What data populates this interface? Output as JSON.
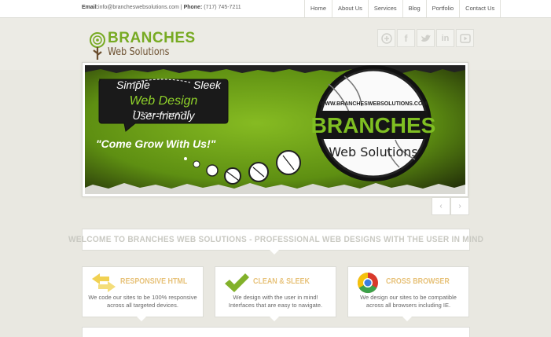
{
  "topbar": {
    "email_label": "Email:",
    "email_value": "info@brancheswebsolutions.com",
    "separator": " | ",
    "phone_label": "Phone:",
    "phone_value": "(717) 745-7211"
  },
  "nav": [
    "Home",
    "About Us",
    "Services",
    "Blog",
    "Portfolio",
    "Contact Us"
  ],
  "logo": {
    "top": "BRANCHES",
    "bottom": "Web Solutions"
  },
  "social_icons": [
    "rss-icon",
    "facebook-icon",
    "twitter-icon",
    "linkedin-icon",
    "youtube-icon"
  ],
  "slide": {
    "bubble_top_left": "Simple",
    "bubble_top_right": "Sleek",
    "bubble_main": "Web Design",
    "bubble_bottom": "User-friendly",
    "tagline": "\"Come Grow With Us!\"",
    "badge_url": "WWW.BRANCHESWEBSOLUTIONS.COM",
    "badge_title": "BRANCHES",
    "badge_subtitle": "Web Solutions"
  },
  "slider_controls": {
    "prev": "‹",
    "next": "›"
  },
  "welcome": "WELCOME TO BRANCHES WEB SOLUTIONS - PROFESSIONAL WEB DESIGNS WITH THE USER IN MIND",
  "features": [
    {
      "title": "RESPONSIVE HTML",
      "desc": "We code our sites to be 100% responsive across all targeted devices.",
      "icon": "arrows-icon"
    },
    {
      "title": "CLEAN & SLEEK",
      "desc": "We design with the user in mind! Interfaces that are easy to navigate.",
      "icon": "checkmark-icon"
    },
    {
      "title": "CROSS BROWSER",
      "desc": "We design our sites to be compatible across all browsers including IE.",
      "icon": "chrome-icon"
    }
  ],
  "colors": {
    "accent_green": "#77aa22",
    "feature_title": "#e7c27a",
    "background": "#e9e8e1"
  }
}
